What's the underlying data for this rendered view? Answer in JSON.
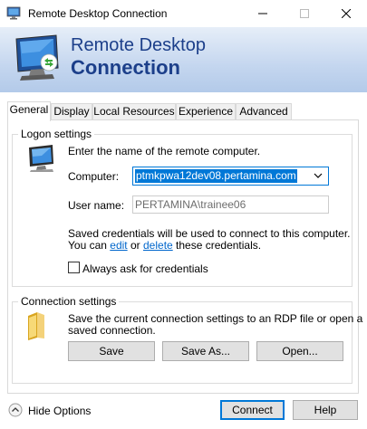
{
  "window": {
    "title": "Remote Desktop Connection",
    "icons": [
      "rdc-app-icon",
      "minimize-icon",
      "maximize-icon",
      "close-icon"
    ]
  },
  "banner": {
    "line1": "Remote Desktop",
    "line2": "Connection",
    "icon": "remote-desktop-monitor-icon"
  },
  "tabs": [
    {
      "label": "General",
      "active": true
    },
    {
      "label": "Display",
      "active": false
    },
    {
      "label": "Local Resources",
      "active": false
    },
    {
      "label": "Experience",
      "active": false
    },
    {
      "label": "Advanced",
      "active": false
    }
  ],
  "logon": {
    "legend": "Logon settings",
    "instruction": "Enter the name of the remote computer.",
    "computer_label": "Computer:",
    "computer_value": "ptmkpwa12dev08.pertamina.com",
    "username_label": "User name:",
    "username_value": "PERTAMINA\\trainee06",
    "saved_line1": "Saved credentials will be used to connect to this computer.",
    "saved_prefix": "You can",
    "edit_link": "edit",
    "or": "or",
    "delete_link": "delete",
    "saved_suffix": "these credentials.",
    "always_ask": "Always ask for credentials",
    "always_ask_checked": false
  },
  "connection": {
    "legend": "Connection settings",
    "desc_line1": "Save the current connection settings to an RDP file or open a",
    "desc_line2": "saved connection.",
    "save": "Save",
    "save_as": "Save As...",
    "open": "Open...",
    "icon": "folder-icon"
  },
  "footer": {
    "hide_options": "Hide Options",
    "connect": "Connect",
    "help": "Help"
  },
  "colors": {
    "accent": "#0078d7",
    "banner_text": "#1c3f8a",
    "link": "#0066cc"
  }
}
